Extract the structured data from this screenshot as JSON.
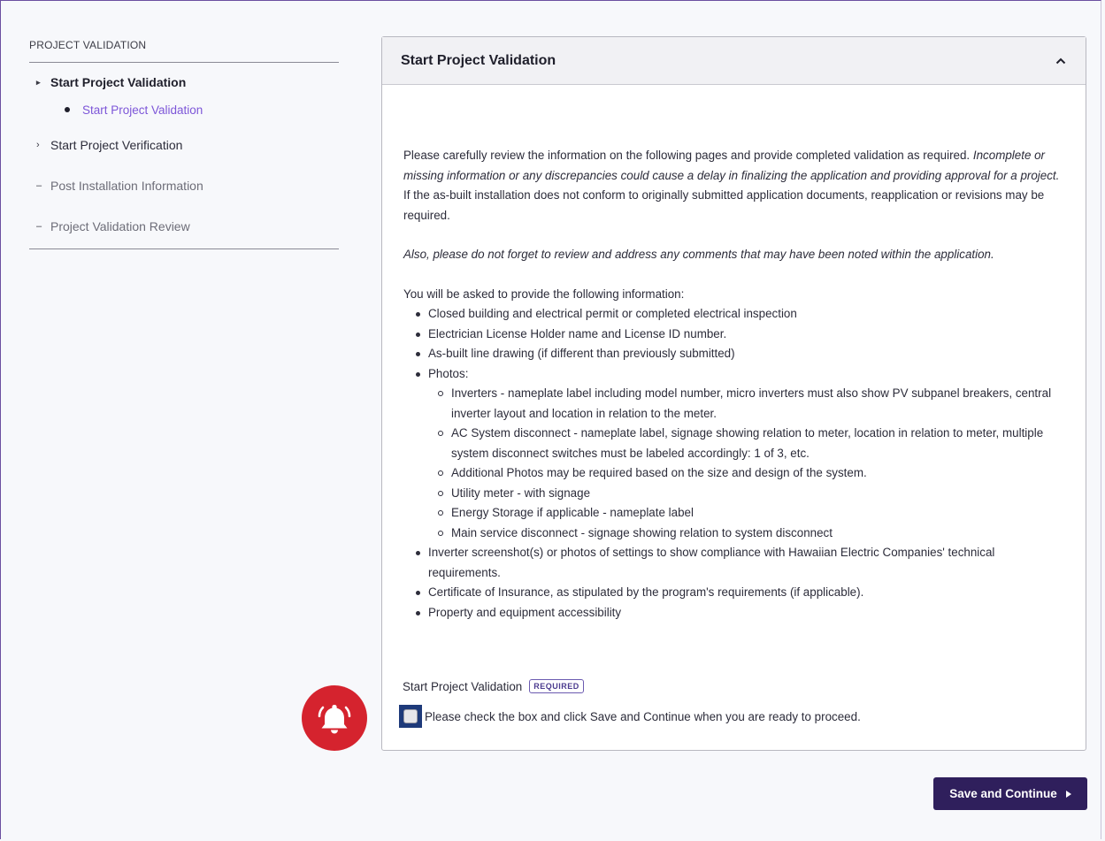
{
  "sidebar": {
    "heading": "PROJECT VALIDATION",
    "items": [
      {
        "label": "Start Project Validation",
        "state": "active",
        "marker": "▸"
      },
      {
        "label": "Start Project Verification",
        "state": "normal",
        "marker": "›"
      },
      {
        "label": "Post Installation Information",
        "state": "muted",
        "marker": "–"
      },
      {
        "label": "Project Validation Review",
        "state": "muted",
        "marker": "–"
      }
    ],
    "sub_item": "Start Project Validation"
  },
  "panel": {
    "title": "Start Project Validation",
    "intro_plain_1": "Please carefully review the information on the following pages and provide completed validation as required.",
    "intro_italic": "Incomplete or missing information or any discrepancies could cause a delay in finalizing the application and providing approval for a project.",
    "intro_plain_2": "If the as-built installation does not conform to originally submitted application documents, reapplication or revisions may be required.",
    "reminder": "Also, please do not forget to review and address any comments that may have been noted within the application.",
    "list_intro": "You will be asked to provide the following information:",
    "items": [
      "Closed building and electrical permit or completed electrical inspection",
      "Electrician License Holder name and License ID number.",
      "As-built line drawing (if different than previously submitted)",
      "Photos:",
      "Inverter screenshot(s) or photos of settings to show compliance with Hawaiian Electric Companies' technical requirements.",
      "Certificate of Insurance, as stipulated by the program's requirements (if applicable).",
      "Property and equipment accessibility"
    ],
    "photo_items": [
      "Inverters - nameplate label including model number, micro inverters must also show PV subpanel breakers, central inverter layout and location in relation to the meter.",
      "AC System disconnect - nameplate label, signage showing relation to meter, location in relation to meter, multiple system disconnect switches must be labeled accordingly: 1 of 3, etc.",
      "Additional Photos may be required based on the size and design of the system.",
      "Utility meter - with signage",
      "Energy Storage if applicable - nameplate label",
      "Main service disconnect - signage showing relation to system disconnect"
    ]
  },
  "confirm": {
    "label": "Start Project Validation",
    "badge": "REQUIRED",
    "checkbox_label": "Please check the box and click Save and Continue when you are ready to proceed.",
    "checked": false
  },
  "actions": {
    "save_label": "Save and Continue"
  },
  "colors": {
    "brand": "#2f1f5c",
    "link": "#7d56d8",
    "alert": "#d5232e",
    "focus": "#1e3a7a"
  }
}
